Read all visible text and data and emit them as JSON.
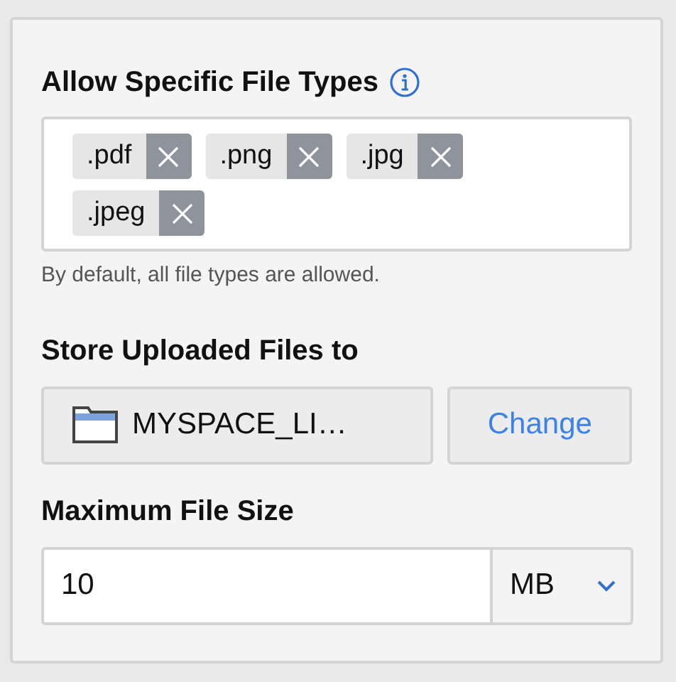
{
  "file_types": {
    "label": "Allow Specific File Types",
    "tags": [
      {
        "label": ".pdf"
      },
      {
        "label": ".png"
      },
      {
        "label": ".jpg"
      },
      {
        "label": ".jpeg"
      }
    ],
    "helper": "By default, all file types are allowed."
  },
  "storage": {
    "label": "Store Uploaded Files to",
    "folder": "MYSPACE_LI…",
    "button": "Change"
  },
  "max_size": {
    "label": "Maximum File Size",
    "value": "10",
    "unit": "MB"
  }
}
